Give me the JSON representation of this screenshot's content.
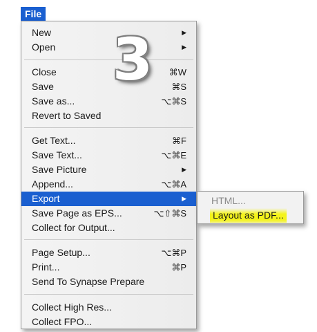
{
  "menubar": {
    "title": "File"
  },
  "badge": {
    "text": "3"
  },
  "menu": {
    "items": [
      {
        "label": "New",
        "shortcut": "",
        "submenu": true
      },
      {
        "label": "Open",
        "shortcut": "",
        "submenu": true
      },
      {
        "label": "Close",
        "shortcut": "⌘W",
        "submenu": false
      },
      {
        "label": "Save",
        "shortcut": "⌘S",
        "submenu": false
      },
      {
        "label": "Save as...",
        "shortcut": "⌥⌘S",
        "submenu": false
      },
      {
        "label": "Revert to Saved",
        "shortcut": "",
        "submenu": false
      },
      {
        "label": "Get Text...",
        "shortcut": "⌘F",
        "submenu": false
      },
      {
        "label": "Save Text...",
        "shortcut": "⌥⌘E",
        "submenu": false
      },
      {
        "label": "Save Picture",
        "shortcut": "",
        "submenu": true
      },
      {
        "label": "Append...",
        "shortcut": "⌥⌘A",
        "submenu": false
      },
      {
        "label": "Export",
        "shortcut": "",
        "submenu": true
      },
      {
        "label": "Save Page as EPS...",
        "shortcut": "⌥⇧⌘S",
        "submenu": false
      },
      {
        "label": "Collect for Output...",
        "shortcut": "",
        "submenu": false
      },
      {
        "label": "Page Setup...",
        "shortcut": "⌥⌘P",
        "submenu": false
      },
      {
        "label": "Print...",
        "shortcut": "⌘P",
        "submenu": false
      },
      {
        "label": "Send To Synapse Prepare",
        "shortcut": "",
        "submenu": false
      },
      {
        "label": "Collect High Res...",
        "shortcut": "",
        "submenu": false
      },
      {
        "label": "Collect FPO...",
        "shortcut": "",
        "submenu": false
      }
    ]
  },
  "submenu": {
    "items": [
      {
        "label": "HTML...",
        "enabled": false
      },
      {
        "label": "Layout as PDF...",
        "enabled": true
      }
    ]
  },
  "colors": {
    "selection": "#1a5fd0",
    "highlighter": "#f4f31c"
  }
}
